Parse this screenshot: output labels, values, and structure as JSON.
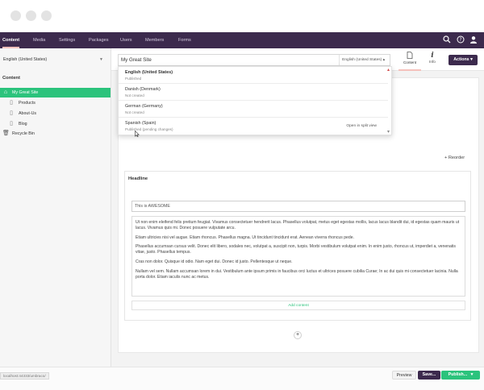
{
  "top_nav": {
    "items": [
      {
        "label": "Content",
        "active": true
      },
      {
        "label": "Media"
      },
      {
        "label": "Settings"
      },
      {
        "label": "Packages"
      },
      {
        "label": "Users"
      },
      {
        "label": "Members"
      },
      {
        "label": "Forms"
      }
    ],
    "icons": [
      "search-icon",
      "help-icon",
      "user-icon"
    ]
  },
  "sidebar": {
    "language": "English (United States)",
    "heading": "Content",
    "tree": [
      {
        "label": "My Great Site",
        "icon": "home-icon",
        "selected": true
      },
      {
        "label": "Products",
        "icon": "page-icon"
      },
      {
        "label": "About-Us",
        "icon": "page-icon"
      },
      {
        "label": "Blog",
        "icon": "page-icon"
      },
      {
        "label": "Recycle Bin",
        "icon": "trash-icon"
      }
    ]
  },
  "editor": {
    "node_name": "My Great Site",
    "variant_label": "English (United States)",
    "tabs": [
      {
        "label": "Content",
        "icon": "document-icon",
        "active": true
      },
      {
        "label": "Info",
        "icon": "info-icon"
      }
    ],
    "actions_label": "Actions"
  },
  "variants_dropdown": {
    "items": [
      {
        "name": "English (United States)",
        "state": "Published",
        "current": true
      },
      {
        "name": "Danish (Denmark)",
        "state": "Not created"
      },
      {
        "name": "German (Germany)",
        "state": "Not created"
      },
      {
        "name": "Spanish (Spain)",
        "state": "Published (pending changes)",
        "split_label": "Open in split view"
      }
    ]
  },
  "content": {
    "reorder_label": "Reorder",
    "block_label": "Headline",
    "headline_value": "This is AWESOME",
    "paragraphs": [
      "Ut non enim eleifend felis pretium feugiat. Vivamus consectetuer hendrerit lacus. Phasellus volutpat, metus eget egestas mollis, lacus lacus blandit dui, id egestas quam mauris ut lacus. Vivamus quis mi. Donec posuere vulputate arcu.",
      "Etiam ultricies nisi vel augue. Etiam rhoncus. Phasellus magna. Ut tincidunt tincidunt erat. Aenean viverra rhoncus pede.",
      "Phasellus accumsan cursus velit. Donec elit libero, sodales nec, volutpat a, suscipit non, turpis. Morbi vestibulum volutpat enim. In enim justo, rhoncus ut, imperdiet a, venenatis vitae, justo. Phasellus tempus.",
      "Cras non dolor. Quisque id odio. Nam eget dui. Donec id justo. Pellentesque ut neque.",
      "Nullam vel sem. Nullam accumsan lorem in dui. Vestibulum ante ipsum primis in faucibus orci luctus et ultrices posuere cubilia Curae; In ac dui quis mi consectetuer lacinia. Nulla porta dolor. Etiam iaculis nunc ac metus."
    ],
    "add_content_label": "Add content"
  },
  "footer": {
    "status_url": "localhost:44333/umbraco/",
    "preview_label": "Preview",
    "save_label": "Save...",
    "publish_label": "Publish...",
    "publish_chevron": "▾"
  },
  "colors": {
    "nav_bg": "#3c2a4d",
    "accent_green": "#2bc37c",
    "active_underline": "#f5c1bc"
  }
}
